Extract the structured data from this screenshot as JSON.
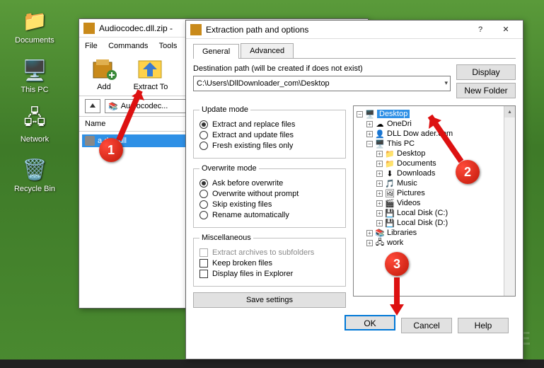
{
  "desktop": {
    "icons": [
      "Documents",
      "This PC",
      "Network",
      "Recycle Bin"
    ]
  },
  "winrar": {
    "title": "Audiocodec.dll.zip - ",
    "menu": [
      "File",
      "Commands",
      "Tools"
    ],
    "toolbar": {
      "add": "Add",
      "extract": "Extract To"
    },
    "path": "Audiocodec...",
    "list_header": "Name",
    "file": "a            dec.dll"
  },
  "dialog": {
    "title": "Extraction path and options",
    "help_glyph": "?",
    "close_glyph": "✕",
    "tabs": {
      "general": "General",
      "advanced": "Advanced"
    },
    "dest_label": "Destination path (will be created if does not exist)",
    "dest_value": "C:\\Users\\DllDownloader_com\\Desktop",
    "btn_display": "Display",
    "btn_newfolder": "New Folder",
    "group_update": {
      "legend": "Update mode",
      "opt1": "Extract and replace files",
      "opt2": "Extract and update files",
      "opt3": "Fresh existing files only"
    },
    "group_overwrite": {
      "legend": "Overwrite mode",
      "opt1": "Ask before overwrite",
      "opt2": "Overwrite without prompt",
      "opt3": "Skip existing files",
      "opt4": "Rename automatically"
    },
    "group_misc": {
      "legend": "Miscellaneous",
      "opt1": "Extract archives to subfolders",
      "opt2": "Keep broken files",
      "opt3": "Display files in Explorer"
    },
    "save": "Save settings",
    "tree": {
      "desktop": "Desktop",
      "onedrive": "OneDri",
      "dlldown": "DLL Dow     ader.com",
      "thispc": "This PC",
      "desktop2": "Desktop",
      "documents": "Documents",
      "downloads": "Downloads",
      "music": "Music",
      "pictures": "Pictures",
      "videos": "Videos",
      "localc": "Local Disk (C:)",
      "locald": "Local Disk (D:)",
      "libraries": "Libraries",
      "network": "work"
    },
    "ok": "OK",
    "cancel": "Cancel",
    "help": "Help"
  },
  "annotation": {
    "n1": "1",
    "n2": "2",
    "n3": "3"
  },
  "watermark": "FREE"
}
